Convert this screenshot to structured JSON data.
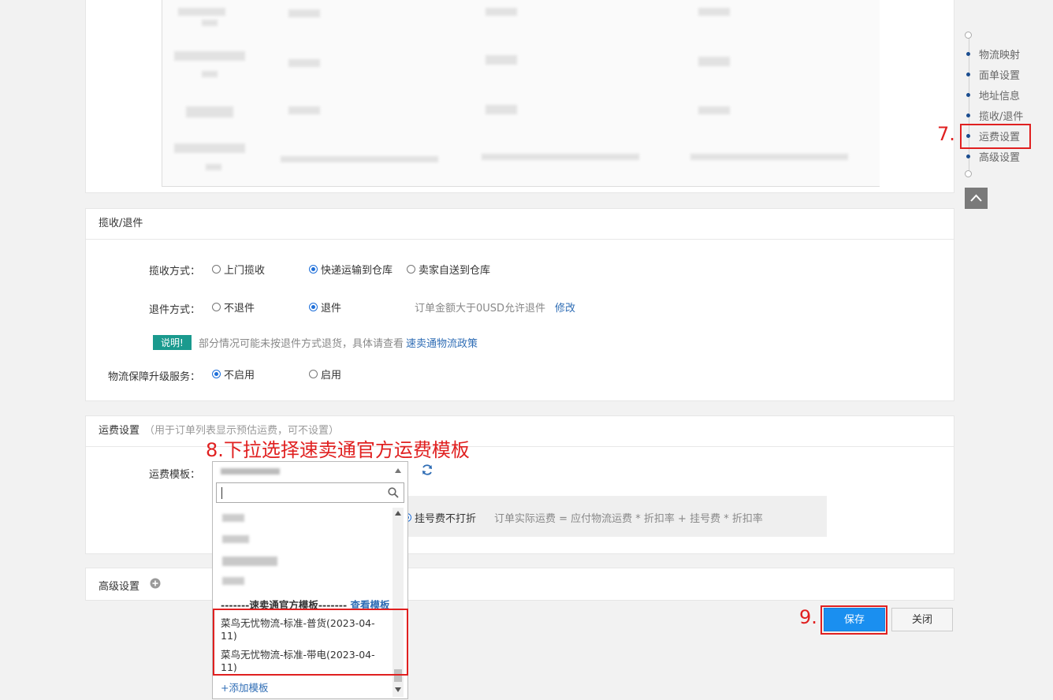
{
  "nav": {
    "items": [
      "物流映射",
      "面单设置",
      "地址信息",
      "揽收/退件",
      "运费设置",
      "高级设置"
    ],
    "back_to_top_icon": "chevron-up-icon"
  },
  "annotations": {
    "step7": "7.",
    "step8": "8.下拉选择速卖通官方运费模板",
    "step9": "9."
  },
  "pickup": {
    "title": "揽收/退件",
    "method_label": "揽收方式：",
    "method_options": [
      "上门揽收",
      "快递运输到仓库",
      "卖家自送到仓库"
    ],
    "method_selected": 1,
    "return_label": "退件方式：",
    "return_options": [
      "不退件",
      "退件"
    ],
    "return_selected": 1,
    "return_note": "订单金额大于0USD允许退件",
    "return_edit": "修改",
    "notice_badge": "说明!",
    "notice_text": "部分情况可能未按退件方式退货，具体请查看",
    "notice_link": "速卖通物流政策",
    "upgrade_label": "物流保障升级服务：",
    "upgrade_options": [
      "不启用",
      "启用"
    ],
    "upgrade_selected": 0
  },
  "freight": {
    "title": "运费设置",
    "subtitle": "（用于订单列表显示预估运费，可不设置）",
    "template_label": "运费模板：",
    "registration_no_discount": "挂号费不打折",
    "formula": "订单实际运费 = 应付物流运费 * 折扣率 + 挂号费 * 折扣率"
  },
  "advanced": {
    "title": "高级设置"
  },
  "dropdown": {
    "search_icon": "search-icon",
    "group_label": "-------速卖通官方模板-------",
    "view_template": "查看模板",
    "options": [
      "菜鸟无忧物流-标准-普货(2023-04-11)",
      "菜鸟无忧物流-标准-带电(2023-04-11)"
    ],
    "add_template": "+添加模板"
  },
  "buttons": {
    "save": "保存",
    "close": "关闭"
  }
}
